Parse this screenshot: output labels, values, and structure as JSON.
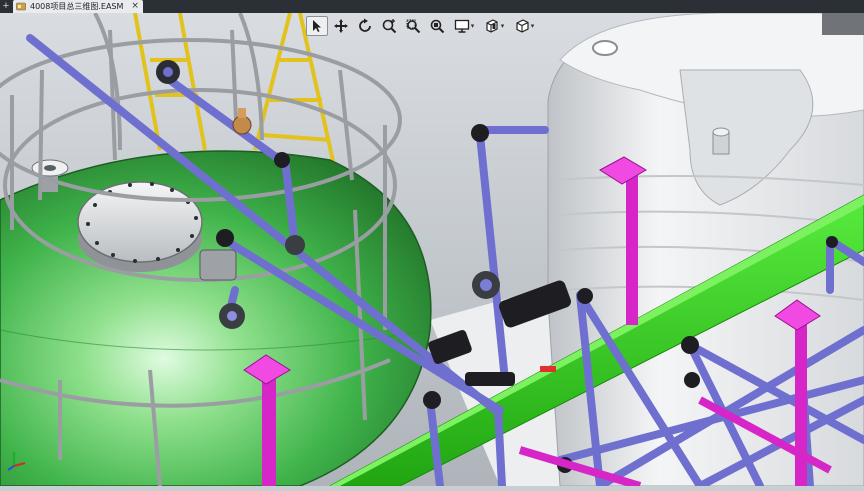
{
  "tab": {
    "title": "4008项目总三维图.EASM",
    "close": "×",
    "new_tab": "+"
  },
  "toolbar": {
    "items": [
      {
        "name": "select",
        "icon": "pointer-icon",
        "active": true
      },
      {
        "name": "pan",
        "icon": "pan-icon"
      },
      {
        "name": "rotate",
        "icon": "rotate-icon"
      },
      {
        "name": "zoom-in-out",
        "icon": "zoom-in-out-icon"
      },
      {
        "name": "zoom-to-area",
        "icon": "zoom-area-icon"
      },
      {
        "name": "zoom-to-fit",
        "icon": "zoom-fit-icon"
      },
      {
        "name": "display",
        "icon": "monitor-icon",
        "dropdown": true
      },
      {
        "name": "section",
        "icon": "section-view-icon",
        "dropdown": true
      },
      {
        "name": "view-orientation",
        "icon": "cube-view-icon",
        "dropdown": true
      }
    ]
  },
  "colors": {
    "tank_green": "#3fb34a",
    "tank_white": "#e6e8ea",
    "pipe_blue": "#6f6fd0",
    "pipe_black": "#1e1e22",
    "support_magenta": "#d726c8",
    "beam_green": "#39d626",
    "ladder_yellow": "#e2c21c",
    "cage_gray": "#9a9ea2"
  }
}
